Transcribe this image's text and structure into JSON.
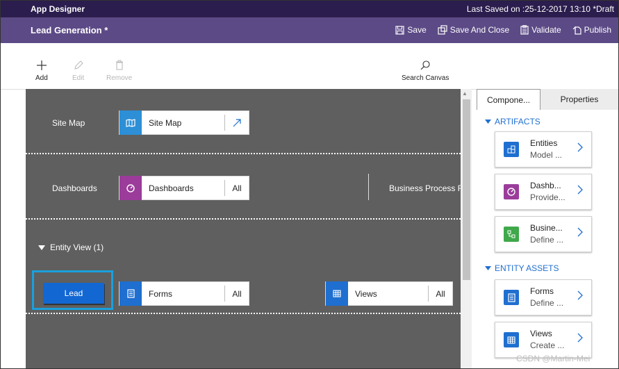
{
  "topbar": {
    "app_title": "App Designer",
    "last_saved": "Last Saved on :25-12-2017 13:10 *Draft"
  },
  "titlebar": {
    "page_title": "Lead Generation *",
    "save": "Save",
    "save_close": "Save And Close",
    "validate": "Validate",
    "publish": "Publish"
  },
  "toolbar": {
    "add": "Add",
    "edit": "Edit",
    "remove": "Remove",
    "search_canvas": "Search Canvas"
  },
  "canvas": {
    "site_map_label": "Site Map",
    "site_map_card": "Site Map",
    "dashboards_label": "Dashboards",
    "dashboards_card": "Dashboards",
    "dashboards_tail": "All",
    "business_process": "Business Process F",
    "entity_view": "Entity View (1)",
    "lead": "Lead",
    "forms_card": "Forms",
    "forms_tail": "All",
    "views_card": "Views",
    "views_tail": "All"
  },
  "panel": {
    "tab_components": "Compone...",
    "tab_properties": "Properties",
    "artifacts_heading": "ARTIFACTS",
    "entity_assets_heading": "ENTITY ASSETS",
    "items": [
      {
        "title": "Entities",
        "desc": "Model ...",
        "icon": "entities-icon",
        "color": "#1e6fd0"
      },
      {
        "title": "Dashb...",
        "desc": "Provide...",
        "icon": "dashboard-icon",
        "color": "#9b3c9b"
      },
      {
        "title": "Busine...",
        "desc": "Define ...",
        "icon": "business-process-icon",
        "color": "#3fa84a"
      },
      {
        "title": "Forms",
        "desc": "Define ...",
        "icon": "forms-icon",
        "color": "#1e6fd0"
      },
      {
        "title": "Views",
        "desc": "Create ...",
        "icon": "views-icon",
        "color": "#1e6fd0"
      }
    ]
  },
  "watermark": "CSDN @Martin-Mei"
}
